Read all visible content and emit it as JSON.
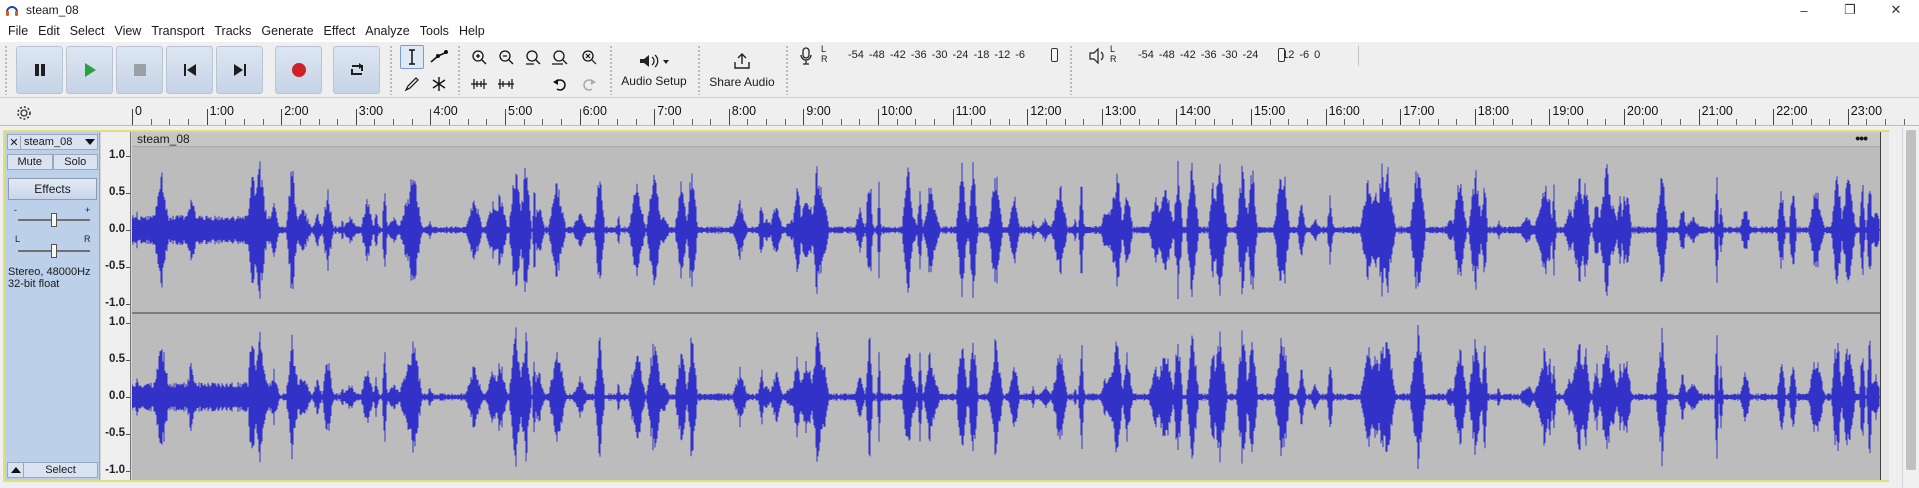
{
  "window": {
    "title": "steam_08",
    "buttons": {
      "minimize": "–",
      "maximize": "❐",
      "close": "✕"
    }
  },
  "menu": [
    "File",
    "Edit",
    "Select",
    "View",
    "Transport",
    "Tracks",
    "Generate",
    "Effect",
    "Analyze",
    "Tools",
    "Help"
  ],
  "toolbar": {
    "audio_setup_label": "Audio Setup",
    "share_audio_label": "Share Audio",
    "record_meter": {
      "channels": "L\nR",
      "scale": [
        "-54",
        "-48",
        "-42",
        "-36",
        "-30",
        "-24",
        "-18",
        "-12",
        "-6"
      ]
    },
    "playback_meter": {
      "channels": "L\nR",
      "scale": [
        "-54",
        "-48",
        "-42",
        "-36",
        "-30",
        "-24",
        "",
        "-12",
        "-6",
        "0"
      ]
    },
    "colors": {
      "record": "#d0202a",
      "play": "#2aa040",
      "button_face": "#c8d4e6"
    }
  },
  "timeline": {
    "ticks": [
      "0",
      "1:00",
      "2:00",
      "3:00",
      "4:00",
      "5:00",
      "6:00",
      "7:00",
      "8:00",
      "9:00",
      "10:00",
      "11:00",
      "12:00",
      "13:00",
      "14:00",
      "15:00",
      "16:00",
      "17:00",
      "18:00",
      "19:00",
      "20:00",
      "21:00",
      "22:00",
      "23:00"
    ]
  },
  "track": {
    "name": "steam_08",
    "mute_label": "Mute",
    "solo_label": "Solo",
    "effects_label": "Effects",
    "gain_minus": "-",
    "gain_plus": "+",
    "pan_left": "L",
    "pan_right": "R",
    "format_line1": "Stereo, 48000Hz",
    "format_line2": "32-bit float",
    "select_label": "Select",
    "scale_labels": [
      "1.0",
      "0.5",
      "0.0",
      "-0.5",
      "-1.0"
    ],
    "clip_name": "steam_08",
    "clip_menu": "•••",
    "colors": {
      "waveform": "#3232c8",
      "waveform_bg": "#bcbcbc",
      "track_border": "#e0e078",
      "control_panel": "#bcd0ea"
    }
  }
}
